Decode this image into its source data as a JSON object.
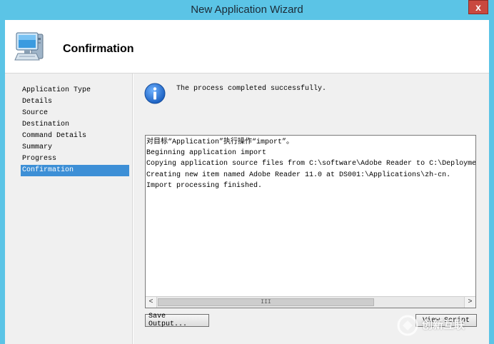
{
  "window": {
    "title": "New Application Wizard",
    "close_glyph": "x"
  },
  "header": {
    "title": "Confirmation",
    "icon": "computer-wizard-icon"
  },
  "sidebar": {
    "items": [
      {
        "label": "Application Type"
      },
      {
        "label": "Details"
      },
      {
        "label": "Source"
      },
      {
        "label": "Destination"
      },
      {
        "label": "Command Details"
      },
      {
        "label": "Summary"
      },
      {
        "label": "Progress"
      },
      {
        "label": "Confirmation",
        "active": true
      }
    ]
  },
  "status": {
    "icon": "info-icon",
    "text": "The process completed successfully."
  },
  "log": {
    "lines": [
      "对目标“Application”执行操作“import”。",
      "Beginning application import",
      "Copying application source files from C:\\software\\Adobe Reader to C:\\DeploymentSha",
      "Creating new item named Adobe Reader 11.0 at DS001:\\Applications\\zh-cn.",
      "Import processing finished."
    ],
    "scroll_left": "<",
    "scroll_right": ">",
    "scroll_grip": "III"
  },
  "buttons": {
    "save_output": "Save Output...",
    "view_script": "View Script"
  },
  "watermark": {
    "text": "创新互联"
  },
  "colors": {
    "titlebar": "#5bc4e6",
    "selection": "#3d8fd6",
    "close": "#c9493f"
  }
}
